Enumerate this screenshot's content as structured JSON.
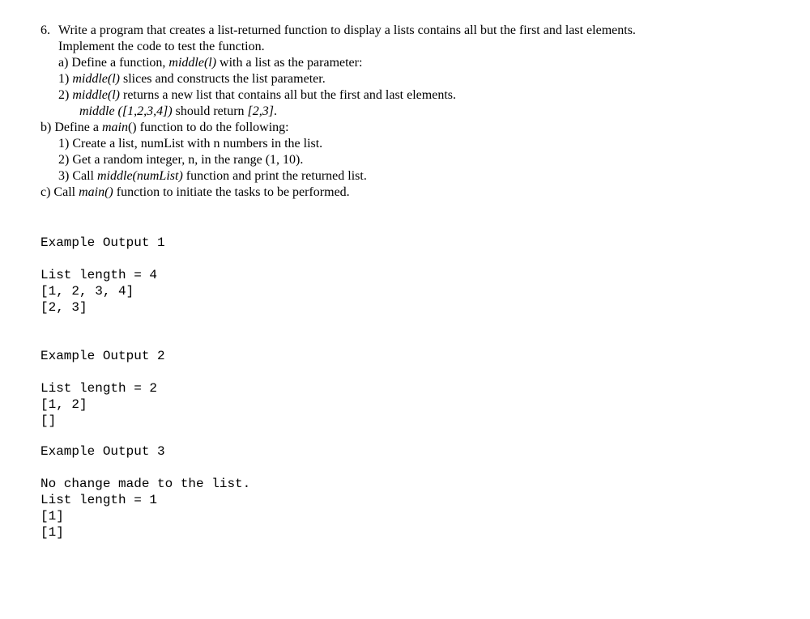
{
  "problem": {
    "number": "6.",
    "line1_a": "Write a program that creates a list-returned function to display a lists contains all but the first and last elements.",
    "line1_b": "Implement the code to test the function.",
    "a_label": "a) Define a function, ",
    "a_func": "middle(l)",
    "a_tail": " with a list as the parameter:",
    "a1_label": "1) ",
    "a1_func": "middle(l)",
    "a1_tail": " slices and constructs the list parameter.",
    "a2_label": "2) ",
    "a2_func": "middle(l)",
    "a2_tail": " returns a new list that contains all but the first and last elements.",
    "a_example_func": "middle ([1,2,3,4])",
    "a_example_mid": " should return ",
    "a_example_ret": "[2,3]",
    "a_example_end": ".",
    "b_label": "b) Define a ",
    "b_func": "main",
    "b_tail": "() function to do the following:",
    "b1": "1) Create a list, numList with n numbers in the list.",
    "b2": "2) Get a random integer, n, in the range (1, 10).",
    "b3_label": "3) Call ",
    "b3_func": "middle(numList)",
    "b3_tail": " function and print the returned list.",
    "c_label": "c) Call ",
    "c_func": "main()",
    "c_tail": " function to initiate the tasks to be performed."
  },
  "output": {
    "ex1_title": "Example Output 1",
    "ex1_line1": "List length = 4",
    "ex1_line2": "[1, 2, 3, 4]",
    "ex1_line3": "[2, 3]",
    "ex2_title": "Example Output 2",
    "ex2_line1": "List length = 2",
    "ex2_line2": "[1, 2]",
    "ex2_line3": "[]",
    "ex3_title": "Example Output 3",
    "ex3_line1": "No change made to the list.",
    "ex3_line2": "List length = 1",
    "ex3_line3": "[1]",
    "ex3_line4": "[1]"
  }
}
